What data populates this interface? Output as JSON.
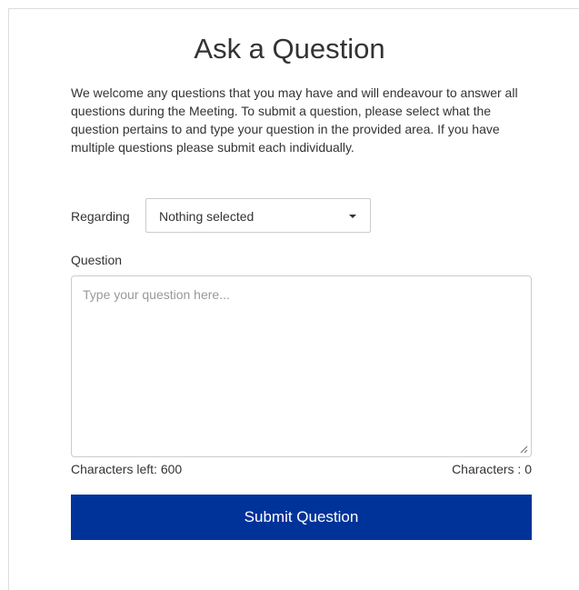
{
  "form": {
    "title": "Ask a Question",
    "intro": "We welcome any questions that you may have and will endeavour to answer all questions during the Meeting. To submit a question, please select what the question pertains to and type your question in the provided area. If you have multiple questions please submit each individually.",
    "regarding_label": "Regarding",
    "regarding_value": "Nothing selected",
    "question_label": "Question",
    "question_value": "",
    "question_placeholder": "Type your question here...",
    "chars_left": "Characters left: 600",
    "chars_count": "Characters : 0",
    "submit_label": "Submit Question"
  },
  "colors": {
    "submit_bg": "#003399",
    "border": "#cccccc"
  },
  "icons": {
    "dropdown": "caret-down-icon",
    "resize": "resize-grip-icon"
  }
}
